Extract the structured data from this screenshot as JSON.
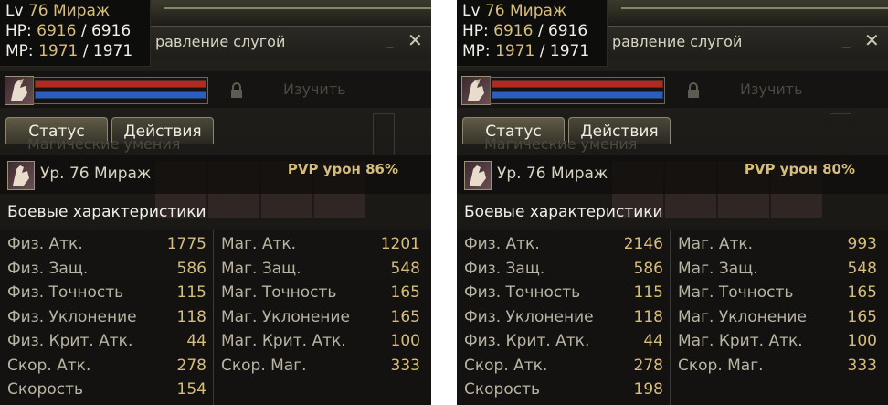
{
  "panels": [
    {
      "badge": {
        "lv_label": "Lv",
        "lv_value": "76",
        "name": "Мираж",
        "hp_label": "HP:",
        "hp_cur": "6916",
        "hp_max": "6916",
        "mp_label": "MP:",
        "mp_cur": "1971",
        "mp_max": "1971"
      },
      "window_title": "равление слугой",
      "min_glyph": "_",
      "close_glyph": "✕",
      "ghost_right": "Изучить",
      "ghost_section": "Магические умения",
      "tabs": {
        "status": "Статус",
        "actions": "Действия"
      },
      "pet_name": "Ур. 76 Мираж",
      "pvp": "PVP урон 86%",
      "section_title": "Боевые характеристики",
      "left_stats": [
        {
          "label": "Физ. Атк.",
          "value": "1775"
        },
        {
          "label": "Физ. Защ.",
          "value": "586"
        },
        {
          "label": "Физ. Точность",
          "value": "115"
        },
        {
          "label": "Физ. Уклонение",
          "value": "118"
        },
        {
          "label": "Физ. Крит. Атк.",
          "value": "44"
        },
        {
          "label": "Скор. Атк.",
          "value": "278"
        },
        {
          "label": "Скорость",
          "value": "154"
        }
      ],
      "right_stats": [
        {
          "label": "Маг. Атк.",
          "value": "1201"
        },
        {
          "label": "Маг. Защ.",
          "value": "548"
        },
        {
          "label": "Маг. Точность",
          "value": "165"
        },
        {
          "label": "Маг. Уклонение",
          "value": "165"
        },
        {
          "label": "Маг. Крит. Атк.",
          "value": "100"
        },
        {
          "label": "Скор. Маг.",
          "value": "333"
        }
      ]
    },
    {
      "badge": {
        "lv_label": "Lv",
        "lv_value": "76",
        "name": "Мираж",
        "hp_label": "HP:",
        "hp_cur": "6916",
        "hp_max": "6916",
        "mp_label": "MP:",
        "mp_cur": "1971",
        "mp_max": "1971"
      },
      "window_title": "равление слугой",
      "min_glyph": "_",
      "close_glyph": "✕",
      "ghost_right": "Изучить",
      "ghost_section": "Магические умения",
      "tabs": {
        "status": "Статус",
        "actions": "Действия"
      },
      "pet_name": "Ур. 76 Мираж",
      "pvp": "PVP урон 80%",
      "section_title": "Боевые характеристики",
      "left_stats": [
        {
          "label": "Физ. Атк.",
          "value": "2146"
        },
        {
          "label": "Физ. Защ.",
          "value": "586"
        },
        {
          "label": "Физ. Точность",
          "value": "115"
        },
        {
          "label": "Физ. Уклонение",
          "value": "118"
        },
        {
          "label": "Физ. Крит. Атк.",
          "value": "44"
        },
        {
          "label": "Скор. Атк.",
          "value": "278"
        },
        {
          "label": "Скорость",
          "value": "198"
        }
      ],
      "right_stats": [
        {
          "label": "Маг. Атк.",
          "value": "993"
        },
        {
          "label": "Маг. Защ.",
          "value": "548"
        },
        {
          "label": "Маг. Точность",
          "value": "165"
        },
        {
          "label": "Маг. Уклонение",
          "value": "165"
        },
        {
          "label": "Маг. Крит. Атк.",
          "value": "100"
        },
        {
          "label": "Скор. Маг.",
          "value": "333"
        }
      ]
    }
  ],
  "colors": {
    "accent_gold": "#d6bd7a",
    "hp_red": "#b32a22",
    "mp_blue": "#2a5fc0",
    "panel_bg": "#1b1a17"
  },
  "icons": {
    "portrait": "mirage-portrait-icon",
    "lock": "lock-icon",
    "minimize": "minimize-icon",
    "close": "close-icon"
  }
}
